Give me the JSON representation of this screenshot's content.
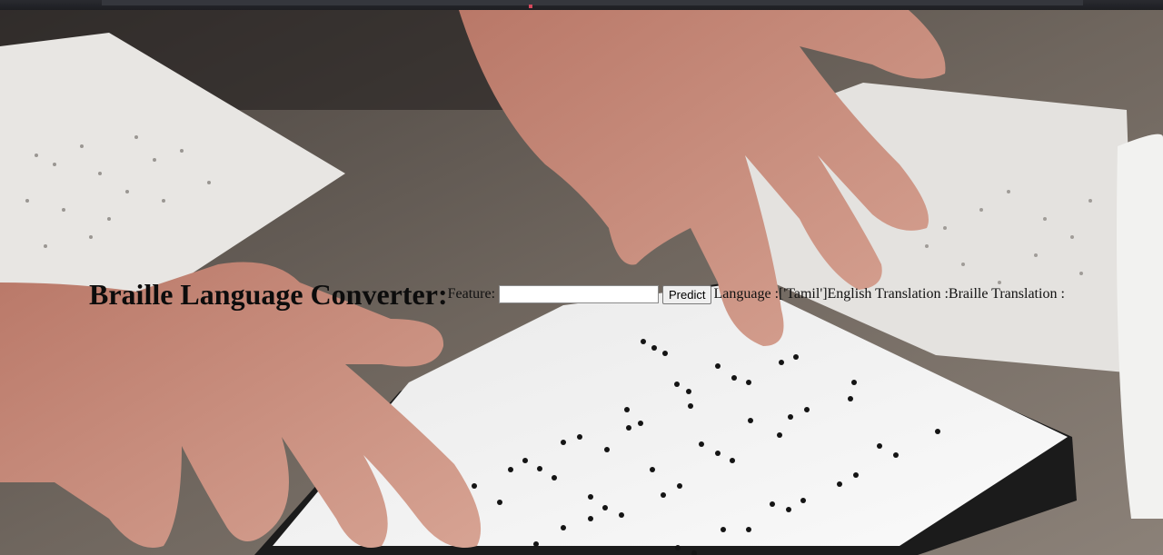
{
  "page": {
    "title": "Braille Language Converter:",
    "feature_label": "Feature:",
    "feature_value": "",
    "predict_label": "Predict",
    "language_text": "Language :['Tamil']",
    "english_text": "English Translation :",
    "braille_text": "Braille Translation :"
  },
  "background": {
    "description_icon": "braille-reading-hands-photo",
    "colors": {
      "table": "#6d655d",
      "paper": "#e9e7e4",
      "board": "#f4f4f4",
      "skin": "#c98b78",
      "dots": "#141414"
    }
  }
}
